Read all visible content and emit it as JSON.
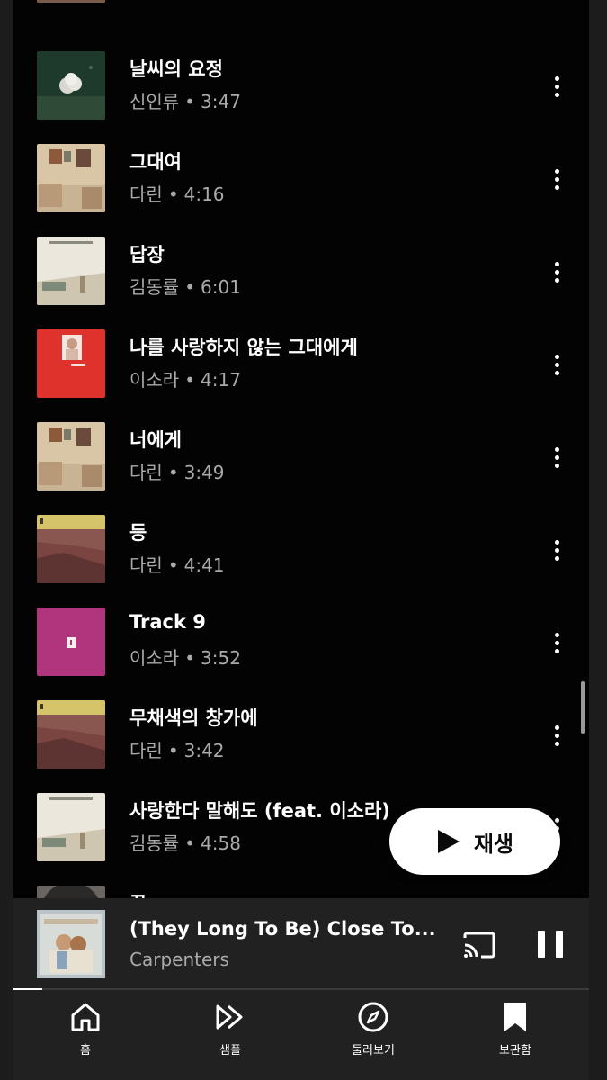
{
  "songs": [
    {
      "title": "날씨의 요정",
      "artist": "신인류",
      "duration": "3:47"
    },
    {
      "title": "그대여",
      "artist": "다린",
      "duration": "4:16"
    },
    {
      "title": "답장",
      "artist": "김동률",
      "duration": "6:01"
    },
    {
      "title": "나를 사랑하지 않는 그대에게",
      "artist": "이소라",
      "duration": "4:17"
    },
    {
      "title": "너에게",
      "artist": "다린",
      "duration": "3:49"
    },
    {
      "title": "등",
      "artist": "다린",
      "duration": "4:41"
    },
    {
      "title": "Track 9",
      "artist": "이소라",
      "duration": "3:52"
    },
    {
      "title": "무채색의 창가에",
      "artist": "다린",
      "duration": "3:42"
    },
    {
      "title": "사랑한다 말해도 (feat. 이소라)",
      "artist": "김동률",
      "duration": "4:58"
    },
    {
      "title": "꿈",
      "artist": "",
      "duration": ""
    }
  ],
  "separator": "•",
  "play_button": {
    "label": "재생",
    "icon": "play-icon"
  },
  "now_playing": {
    "title": "(They Long To Be) Close To...",
    "artist": "Carpenters",
    "progress": 0.05,
    "icons": [
      "cast-icon",
      "pause-icon"
    ]
  },
  "nav": {
    "items": [
      {
        "label": "홈",
        "icon": "home-icon"
      },
      {
        "label": "샘플",
        "icon": "samples-icon"
      },
      {
        "label": "둘러보기",
        "icon": "explore-icon"
      },
      {
        "label": "보관함",
        "icon": "library-icon"
      }
    ]
  },
  "colors": {
    "background": "#030303",
    "panel": "#212121",
    "secondary_text": "#aaaaaa",
    "accent": "#ffffff"
  }
}
